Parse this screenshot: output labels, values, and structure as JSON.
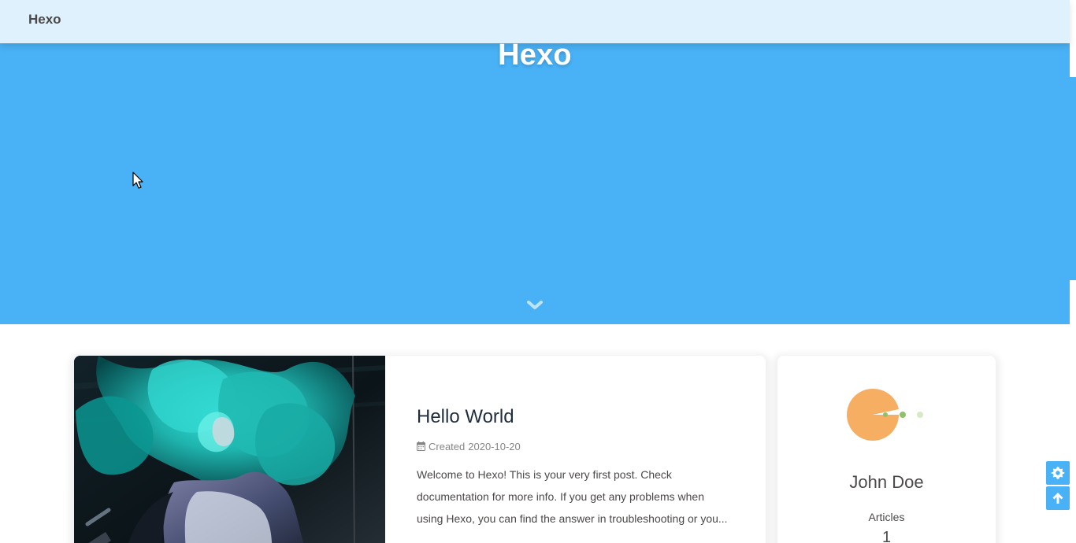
{
  "navbar": {
    "site_name": "Hexo"
  },
  "hero": {
    "title": "Hexo",
    "background_color": "#49b1f5",
    "scroll_icon": "chevron-down-icon"
  },
  "post": {
    "title": "Hello World",
    "created_label": "Created",
    "created_date": "2020-10-20",
    "excerpt_lines": [
      "Welcome to Hexo! This is your very first post. Check",
      "documentation for more info. If you get any problems when",
      "using Hexo, you can find the answer in troubleshooting or you..."
    ],
    "cover_icon": "cover-image"
  },
  "profile": {
    "name": "John Doe",
    "articles_label": "Articles",
    "articles_count": "1",
    "avatar_icon": "loading-avatar-icon"
  },
  "floating_actions": {
    "settings_icon": "gear-icon",
    "back_to_top_icon": "arrow-up-icon"
  },
  "colors": {
    "accent": "#49b1f5",
    "text": "#4c4948",
    "title": "#1f2d3d",
    "meta": "#858585",
    "avatar_orange": "#f6ae63",
    "avatar_green": "#8fc06a"
  }
}
